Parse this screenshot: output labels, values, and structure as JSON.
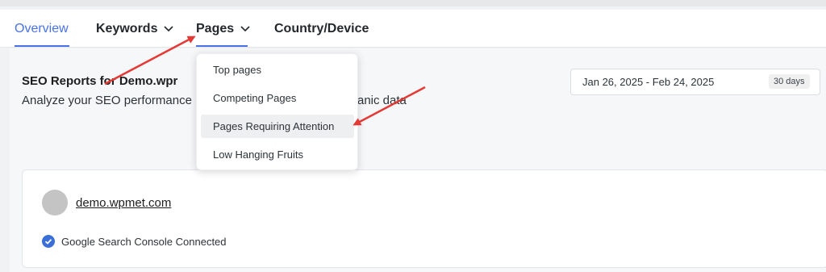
{
  "tabs": {
    "overview": "Overview",
    "keywords": "Keywords",
    "pages": "Pages",
    "country_device": "Country/Device"
  },
  "header": {
    "title": "SEO Reports for Demo.wpr",
    "subtitle_left": "Analyze your SEO performance",
    "subtitle_right": "anic data"
  },
  "date_range": {
    "value": "Jan 26, 2025 - Feb 24, 2025",
    "badge": "30 days"
  },
  "pages_menu": {
    "items": [
      "Top pages",
      "Competing Pages",
      "Pages Requiring Attention",
      "Low Hanging Fruits"
    ],
    "highlighted_index": 2
  },
  "site_card": {
    "site": "demo.wpmet.com",
    "status": "Google Search Console Connected"
  },
  "colors": {
    "accent": "#4a72e8",
    "annotation_arrow": "#e53935",
    "check": "#3b6fd8"
  },
  "icons": [
    "chevron-down-icon",
    "check-circle-icon",
    "avatar"
  ]
}
